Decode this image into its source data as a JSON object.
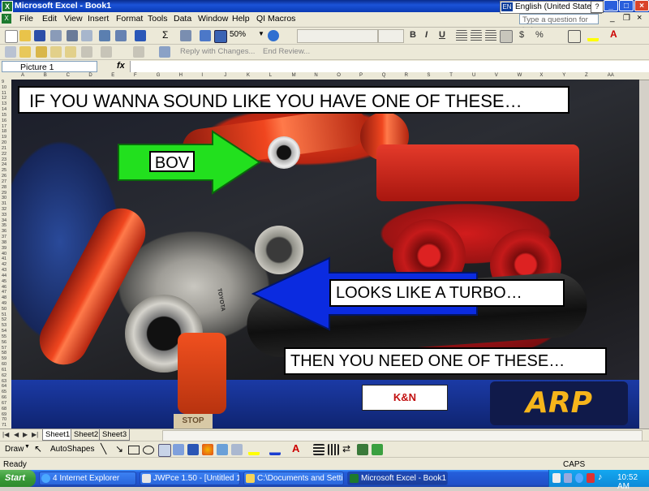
{
  "window": {
    "title": "Microsoft Excel - Book1",
    "app_icon": "excel-icon"
  },
  "language_bar": {
    "code": "EN",
    "label": "English (United States)"
  },
  "help_box": {
    "placeholder": "Type a question for help"
  },
  "menu": [
    "File",
    "Edit",
    "View",
    "Insert",
    "Format",
    "Tools",
    "Data",
    "Window",
    "Help",
    "QI Macros"
  ],
  "standard_toolbar": {
    "zoom": "50%"
  },
  "formatting_toolbar": {
    "bold": "B",
    "italic": "I",
    "underline": "U",
    "currency": "$",
    "percent": "%"
  },
  "review_toolbar": {
    "reply": "Reply with Changes...",
    "end_review": "End Review..."
  },
  "formula_bar": {
    "name_box": "Picture 1",
    "fx": "fx"
  },
  "column_headers": [
    "A",
    "B",
    "C",
    "D",
    "E",
    "F",
    "G",
    "H",
    "I",
    "J",
    "K",
    "L",
    "M",
    "N",
    "O",
    "P",
    "Q",
    "R",
    "S",
    "T",
    "U",
    "V",
    "W",
    "X",
    "Y",
    "Z",
    "AA"
  ],
  "row_start": 9,
  "row_end": 71,
  "picture": {
    "captions": {
      "headline": "IF YOU WANNA SOUND LIKE YOU HAVE ONE OF THESE…",
      "bov": "BOV",
      "turbo": "LOOKS LIKE A TURBO…",
      "need": "THEN YOU NEED ONE OF THESE…",
      "kn": "K&N",
      "arp": "ARP",
      "stop": "STOP",
      "toyota": "TOYOTA"
    },
    "colors": {
      "green_arrow": "#22e01e",
      "blue_arrow": "#0b2be0",
      "pipe_red": "#e8401c"
    }
  },
  "sheet_tabs": [
    "Sheet1",
    "Sheet2",
    "Sheet3"
  ],
  "active_sheet": "Sheet1",
  "drawing_toolbar": {
    "draw": "Draw",
    "autoshapes": "AutoShapes"
  },
  "status_bar": {
    "left": "Ready",
    "caps": "CAPS"
  },
  "taskbar": {
    "start": "Start",
    "tasks": [
      {
        "label": "4 Internet Explorer",
        "icon": "ie-icon"
      },
      {
        "label": "JWPce 1.50 - [Untitled 1]",
        "icon": "jwpce-icon"
      },
      {
        "label": "C:\\Documents and Setti...",
        "icon": "folder-icon"
      },
      {
        "label": "Microsoft Excel - Book1",
        "icon": "excel-icon"
      }
    ],
    "clock": "10:52 AM"
  }
}
